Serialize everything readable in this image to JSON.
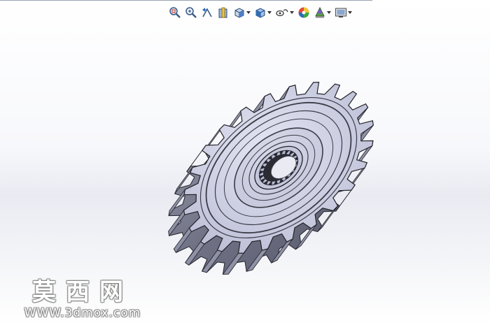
{
  "toolbar": {
    "buttons": [
      {
        "icon": "zoom-to-fit-icon",
        "has_menu": false
      },
      {
        "icon": "zoom-to-area-icon",
        "has_menu": false
      },
      {
        "icon": "previous-view-icon",
        "has_menu": false
      },
      {
        "icon": "section-view-icon",
        "has_menu": false
      },
      {
        "icon": "view-orientation-icon",
        "has_menu": true
      },
      {
        "icon": "display-style-icon",
        "has_menu": true
      },
      {
        "icon": "hide-show-items-icon",
        "has_menu": true
      },
      {
        "icon": "edit-appearance-icon",
        "has_menu": false
      },
      {
        "icon": "apply-scene-icon",
        "has_menu": true
      },
      {
        "icon": "view-settings-icon",
        "has_menu": true
      }
    ]
  },
  "model": {
    "part": "helical-spur-gear",
    "tooth_count": 24,
    "spline_count": 20,
    "color_face": "#cfd1e6",
    "color_edge": "#222228"
  },
  "watermark": {
    "title": "莫西网",
    "url": "WWW.3dmox.com"
  }
}
